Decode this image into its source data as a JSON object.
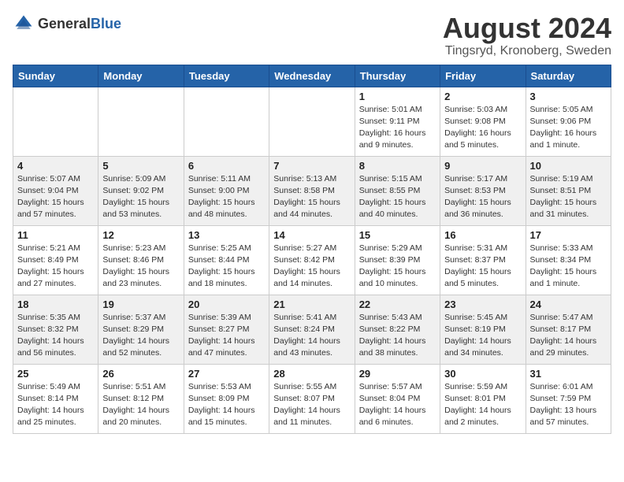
{
  "header": {
    "logo_general": "General",
    "logo_blue": "Blue",
    "month_title": "August 2024",
    "location": "Tingsryd, Kronoberg, Sweden"
  },
  "weekdays": [
    "Sunday",
    "Monday",
    "Tuesday",
    "Wednesday",
    "Thursday",
    "Friday",
    "Saturday"
  ],
  "weeks": [
    [
      {
        "day": "",
        "info": ""
      },
      {
        "day": "",
        "info": ""
      },
      {
        "day": "",
        "info": ""
      },
      {
        "day": "",
        "info": ""
      },
      {
        "day": "1",
        "info": "Sunrise: 5:01 AM\nSunset: 9:11 PM\nDaylight: 16 hours\nand 9 minutes."
      },
      {
        "day": "2",
        "info": "Sunrise: 5:03 AM\nSunset: 9:08 PM\nDaylight: 16 hours\nand 5 minutes."
      },
      {
        "day": "3",
        "info": "Sunrise: 5:05 AM\nSunset: 9:06 PM\nDaylight: 16 hours\nand 1 minute."
      }
    ],
    [
      {
        "day": "4",
        "info": "Sunrise: 5:07 AM\nSunset: 9:04 PM\nDaylight: 15 hours\nand 57 minutes."
      },
      {
        "day": "5",
        "info": "Sunrise: 5:09 AM\nSunset: 9:02 PM\nDaylight: 15 hours\nand 53 minutes."
      },
      {
        "day": "6",
        "info": "Sunrise: 5:11 AM\nSunset: 9:00 PM\nDaylight: 15 hours\nand 48 minutes."
      },
      {
        "day": "7",
        "info": "Sunrise: 5:13 AM\nSunset: 8:58 PM\nDaylight: 15 hours\nand 44 minutes."
      },
      {
        "day": "8",
        "info": "Sunrise: 5:15 AM\nSunset: 8:55 PM\nDaylight: 15 hours\nand 40 minutes."
      },
      {
        "day": "9",
        "info": "Sunrise: 5:17 AM\nSunset: 8:53 PM\nDaylight: 15 hours\nand 36 minutes."
      },
      {
        "day": "10",
        "info": "Sunrise: 5:19 AM\nSunset: 8:51 PM\nDaylight: 15 hours\nand 31 minutes."
      }
    ],
    [
      {
        "day": "11",
        "info": "Sunrise: 5:21 AM\nSunset: 8:49 PM\nDaylight: 15 hours\nand 27 minutes."
      },
      {
        "day": "12",
        "info": "Sunrise: 5:23 AM\nSunset: 8:46 PM\nDaylight: 15 hours\nand 23 minutes."
      },
      {
        "day": "13",
        "info": "Sunrise: 5:25 AM\nSunset: 8:44 PM\nDaylight: 15 hours\nand 18 minutes."
      },
      {
        "day": "14",
        "info": "Sunrise: 5:27 AM\nSunset: 8:42 PM\nDaylight: 15 hours\nand 14 minutes."
      },
      {
        "day": "15",
        "info": "Sunrise: 5:29 AM\nSunset: 8:39 PM\nDaylight: 15 hours\nand 10 minutes."
      },
      {
        "day": "16",
        "info": "Sunrise: 5:31 AM\nSunset: 8:37 PM\nDaylight: 15 hours\nand 5 minutes."
      },
      {
        "day": "17",
        "info": "Sunrise: 5:33 AM\nSunset: 8:34 PM\nDaylight: 15 hours\nand 1 minute."
      }
    ],
    [
      {
        "day": "18",
        "info": "Sunrise: 5:35 AM\nSunset: 8:32 PM\nDaylight: 14 hours\nand 56 minutes."
      },
      {
        "day": "19",
        "info": "Sunrise: 5:37 AM\nSunset: 8:29 PM\nDaylight: 14 hours\nand 52 minutes."
      },
      {
        "day": "20",
        "info": "Sunrise: 5:39 AM\nSunset: 8:27 PM\nDaylight: 14 hours\nand 47 minutes."
      },
      {
        "day": "21",
        "info": "Sunrise: 5:41 AM\nSunset: 8:24 PM\nDaylight: 14 hours\nand 43 minutes."
      },
      {
        "day": "22",
        "info": "Sunrise: 5:43 AM\nSunset: 8:22 PM\nDaylight: 14 hours\nand 38 minutes."
      },
      {
        "day": "23",
        "info": "Sunrise: 5:45 AM\nSunset: 8:19 PM\nDaylight: 14 hours\nand 34 minutes."
      },
      {
        "day": "24",
        "info": "Sunrise: 5:47 AM\nSunset: 8:17 PM\nDaylight: 14 hours\nand 29 minutes."
      }
    ],
    [
      {
        "day": "25",
        "info": "Sunrise: 5:49 AM\nSunset: 8:14 PM\nDaylight: 14 hours\nand 25 minutes."
      },
      {
        "day": "26",
        "info": "Sunrise: 5:51 AM\nSunset: 8:12 PM\nDaylight: 14 hours\nand 20 minutes."
      },
      {
        "day": "27",
        "info": "Sunrise: 5:53 AM\nSunset: 8:09 PM\nDaylight: 14 hours\nand 15 minutes."
      },
      {
        "day": "28",
        "info": "Sunrise: 5:55 AM\nSunset: 8:07 PM\nDaylight: 14 hours\nand 11 minutes."
      },
      {
        "day": "29",
        "info": "Sunrise: 5:57 AM\nSunset: 8:04 PM\nDaylight: 14 hours\nand 6 minutes."
      },
      {
        "day": "30",
        "info": "Sunrise: 5:59 AM\nSunset: 8:01 PM\nDaylight: 14 hours\nand 2 minutes."
      },
      {
        "day": "31",
        "info": "Sunrise: 6:01 AM\nSunset: 7:59 PM\nDaylight: 13 hours\nand 57 minutes."
      }
    ]
  ]
}
